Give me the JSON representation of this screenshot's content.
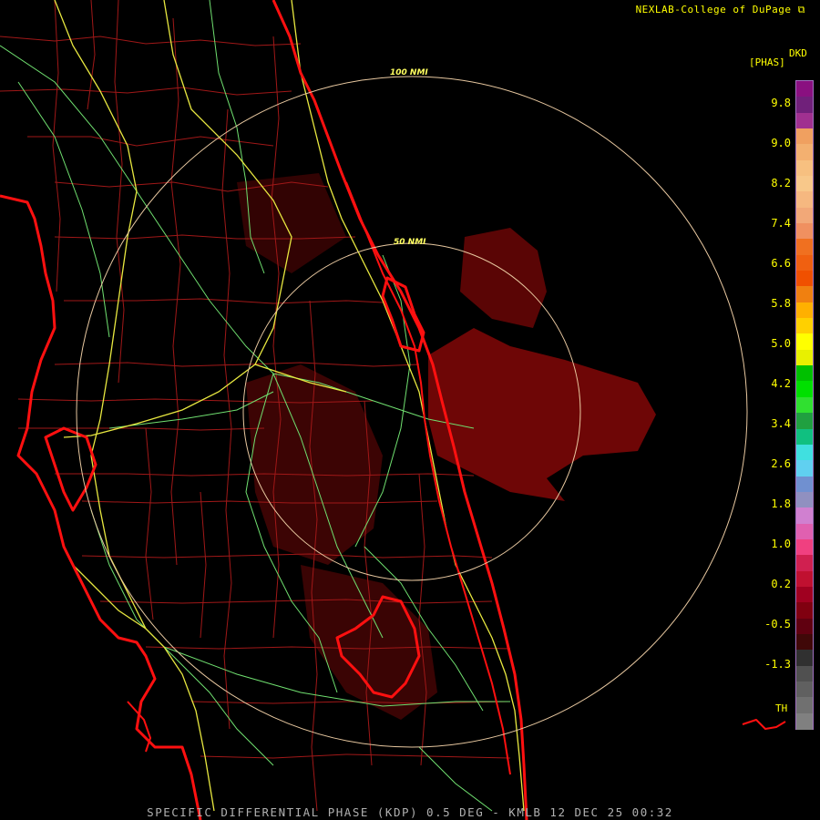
{
  "credit": {
    "text": "NEXLAB-College of DuPage",
    "icon": "nexlab-logo-icon"
  },
  "legend": {
    "product_code": "DKD",
    "product_units": "[PHAS]",
    "ticks": [
      "9.8",
      "9.0",
      "8.2",
      "7.4",
      "6.6",
      "5.8",
      "5.0",
      "4.2",
      "3.4",
      "2.6",
      "1.8",
      "1.0",
      "0.2",
      "-0.5",
      "-1.3"
    ],
    "threshold_label": "TH",
    "colors": [
      "#8a1080",
      "#70207a",
      "#a03090",
      "#f0a060",
      "#f3b070",
      "#f7c080",
      "#f8c88a",
      "#f6b880",
      "#f2a878",
      "#f09060",
      "#f07020",
      "#f06010",
      "#f05000",
      "#f08010",
      "#ffb000",
      "#ffd000",
      "#ffff00",
      "#e8f000",
      "#00c000",
      "#00e000",
      "#30e030",
      "#20a040",
      "#10c080",
      "#40e0e0",
      "#60d0f0",
      "#7090d0",
      "#9090c0",
      "#d080d0",
      "#e060b0",
      "#f04080",
      "#d02050",
      "#c01030",
      "#a00020",
      "#800010",
      "#600010",
      "#400808",
      "#303030",
      "#505050",
      "#606060",
      "#707070",
      "#808080"
    ]
  },
  "rings": {
    "outer_label": "100 NMI",
    "inner_label": "50 NMI"
  },
  "footer": {
    "text": "SPECIFIC DIFFERENTIAL PHASE (KDP) 0.5 DEG - KMLB 12 DEC 25 00:32"
  },
  "style_colors": {
    "coast": "#ff1010",
    "county": "#a01818",
    "road_major": "#e8e840",
    "road_minor": "#70e070",
    "ring": "#e8c8a0",
    "echo": "#7a0808"
  }
}
